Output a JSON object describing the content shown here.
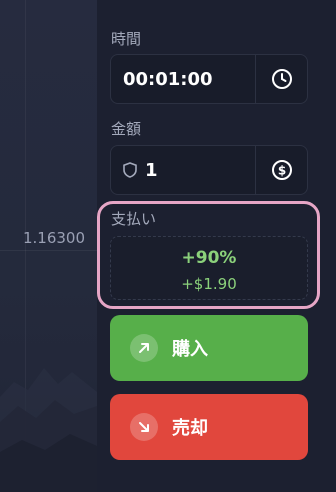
{
  "chart": {
    "price_label": "1.16300"
  },
  "time": {
    "label": "時間",
    "value": "00:01:00",
    "icon": "clock-icon"
  },
  "amount": {
    "label": "金額",
    "value": "1",
    "currency_icon": "dollar-circle-icon",
    "shield_icon": "shield-icon"
  },
  "payout": {
    "label": "支払い",
    "percent": "+90%",
    "amount": "+$1.90",
    "color": "#8bd17b",
    "highlight_color": "#e6a6c6"
  },
  "buttons": {
    "buy_label": "購入",
    "sell_label": "売却",
    "buy_color": "#57af4a",
    "sell_color": "#e1473d"
  }
}
